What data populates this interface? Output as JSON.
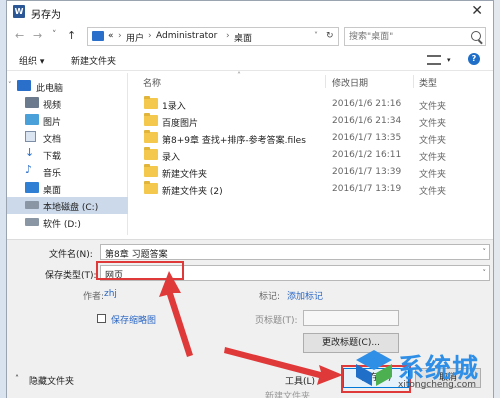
{
  "window": {
    "title": "另存为",
    "app_icon_letter": "W",
    "close_glyph": "✕"
  },
  "address_bar": {
    "back": "←",
    "forward": "→",
    "up_down": "˅",
    "up": "↑",
    "segments": [
      "«",
      "用户",
      "Administrator",
      "桌面"
    ],
    "separators": [
      "›",
      "›",
      "›"
    ],
    "search_placeholder": "搜索\"桌面\""
  },
  "toolbar": {
    "organize": "组织 ▾",
    "new_folder": "新建文件夹"
  },
  "nav": [
    {
      "label": "此电脑",
      "icon": "computer-icon"
    },
    {
      "label": "视频",
      "icon": "video-icon"
    },
    {
      "label": "图片",
      "icon": "picture-icon"
    },
    {
      "label": "文档",
      "icon": "document-icon"
    },
    {
      "label": "下载",
      "icon": "download-icon"
    },
    {
      "label": "音乐",
      "icon": "music-icon"
    },
    {
      "label": "桌面",
      "icon": "desktop-icon"
    },
    {
      "label": "本地磁盘 (C:)",
      "icon": "disk-icon"
    },
    {
      "label": "软件 (D:)",
      "icon": "disk-icon"
    }
  ],
  "columns": {
    "name": "名称",
    "date": "修改日期",
    "type": "类型"
  },
  "files": [
    {
      "name": "1录入",
      "date": "2016/1/6 21:16",
      "type": "文件夹"
    },
    {
      "name": "百度图片",
      "date": "2016/1/6 21:34",
      "type": "文件夹"
    },
    {
      "name": "第8+9章 查找+排序-参考答案.files",
      "date": "2016/1/7 13:35",
      "type": "文件夹"
    },
    {
      "name": "录入",
      "date": "2016/1/2 16:11",
      "type": "文件夹"
    },
    {
      "name": "新建文件夹",
      "date": "2016/1/7 13:39",
      "type": "文件夹"
    },
    {
      "name": "新建文件夹 (2)",
      "date": "2016/1/7 13:19",
      "type": "文件夹"
    }
  ],
  "form": {
    "filename_label": "文件名(N):",
    "filename_value": "第8章 习题答案",
    "savetype_label": "保存类型(T):",
    "savetype_value": "网页",
    "author_label": "作者:",
    "author_value": "zhj",
    "tags_label": "标记:",
    "tags_value": "添加标记",
    "thumbnail_label": "保存缩略图",
    "pagetitle_label": "页标题(T):",
    "change_title_button": "更改标题(C)..."
  },
  "footer": {
    "hide_folders": "隐藏文件夹",
    "tools": "工具(L)",
    "save": "保存(S)",
    "cancel": "取消"
  },
  "watermark": {
    "title": "系统城",
    "sub": "xitongcheng.com"
  },
  "colors": {
    "accent": "#2f8fe6",
    "annotation": "#e0393a",
    "selected": "#ccd9ea"
  }
}
